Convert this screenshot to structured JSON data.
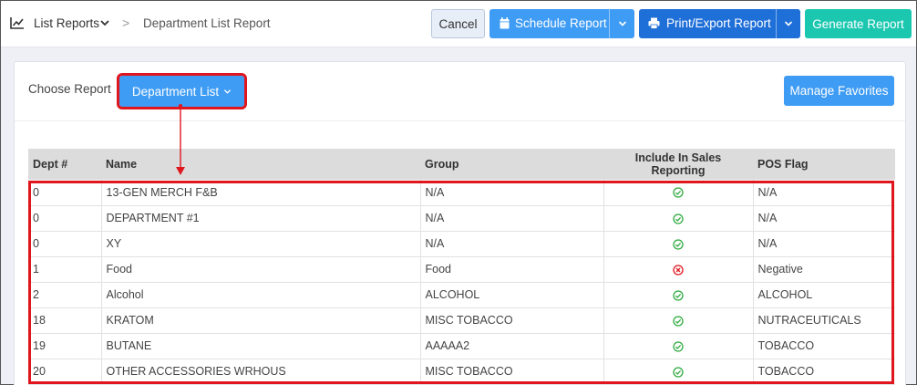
{
  "breadcrumb": {
    "root_icon": "line-chart-icon",
    "root_label": "List Reports",
    "separator": ">",
    "current": "Department List Report"
  },
  "toolbar": {
    "cancel_label": "Cancel",
    "schedule_label": "Schedule Report",
    "schedule_icon": "calendar-icon",
    "print_label": "Print/Export Report",
    "print_icon": "printer-icon",
    "generate_label": "Generate Report"
  },
  "panel": {
    "choose_label": "Choose Report",
    "report_select_value": "Department List",
    "manage_favorites_label": "Manage Favorites"
  },
  "table": {
    "headers": [
      "Dept #",
      "Name",
      "Group",
      "Include In Sales Reporting",
      "POS Flag"
    ],
    "rows": [
      {
        "dept": "0",
        "name": "13-GEN MERCH F&B",
        "group": "N/A",
        "include": true,
        "pos_flag": "N/A"
      },
      {
        "dept": "0",
        "name": "DEPARTMENT #1",
        "group": "N/A",
        "include": true,
        "pos_flag": "N/A"
      },
      {
        "dept": "0",
        "name": "XY",
        "group": "N/A",
        "include": true,
        "pos_flag": "N/A"
      },
      {
        "dept": "1",
        "name": "Food",
        "group": "Food",
        "include": false,
        "pos_flag": "Negative"
      },
      {
        "dept": "2",
        "name": "Alcohol",
        "group": "ALCOHOL",
        "include": true,
        "pos_flag": "ALCOHOL"
      },
      {
        "dept": "18",
        "name": "KRATOM",
        "group": "MISC TOBACCO",
        "include": true,
        "pos_flag": "NUTRACEUTICALS"
      },
      {
        "dept": "19",
        "name": "BUTANE",
        "group": "AAAAA2",
        "include": true,
        "pos_flag": "TOBACCO"
      },
      {
        "dept": "20",
        "name": "OTHER ACCESSORIES WRHOUS",
        "group": "MISC TOBACCO",
        "include": true,
        "pos_flag": "TOBACCO"
      }
    ]
  },
  "colors": {
    "primary_blue": "#3f9cf4",
    "dark_blue": "#1f6fd8",
    "teal": "#1cc7b0",
    "highlight_red": "#e0161e",
    "check_green": "#2eaa3f",
    "cross_red": "#e0161e"
  }
}
